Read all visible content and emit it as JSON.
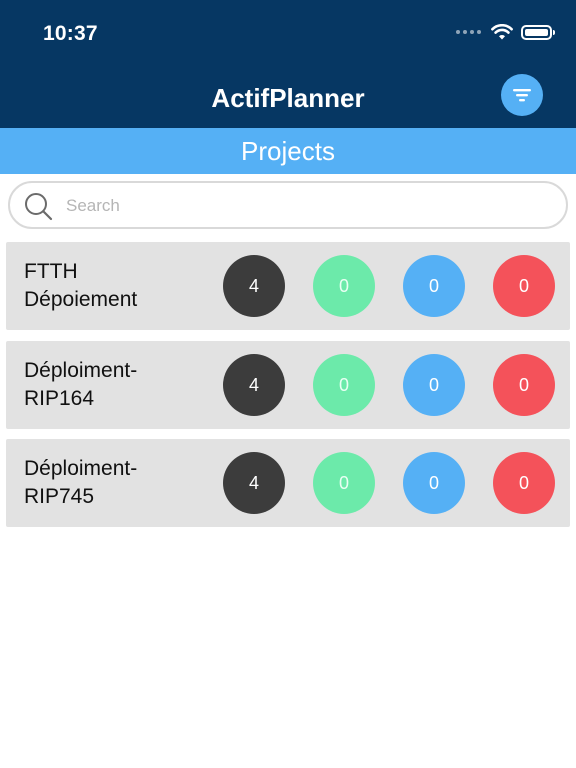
{
  "status_bar": {
    "time": "10:37",
    "icons": [
      "signal-dots-icon",
      "wifi-icon",
      "battery-icon"
    ]
  },
  "header": {
    "title": "ActifPlanner",
    "filter_icon": "filter-icon"
  },
  "subheader": {
    "title": "Projects"
  },
  "search": {
    "placeholder": "Search",
    "value": "",
    "icon": "search-icon"
  },
  "projects": [
    {
      "name": "FTTH\nDépoiement",
      "total": "4",
      "done": "0",
      "in_progress": "0",
      "late": "0"
    },
    {
      "name": "Déploiment-\nRIP164",
      "total": "4",
      "done": "0",
      "in_progress": "0",
      "late": "0"
    },
    {
      "name": "Déploiment-\nRIP745",
      "total": "4",
      "done": "0",
      "in_progress": "0",
      "late": "0"
    }
  ],
  "colors": {
    "header_bg": "#063763",
    "accent_blue": "#55b0f5",
    "row_bg": "#e2e2e2",
    "badge_total": "#3c3c3c",
    "badge_done": "#6ceaaa",
    "badge_progress": "#55b0f5",
    "badge_late": "#f4525a"
  }
}
